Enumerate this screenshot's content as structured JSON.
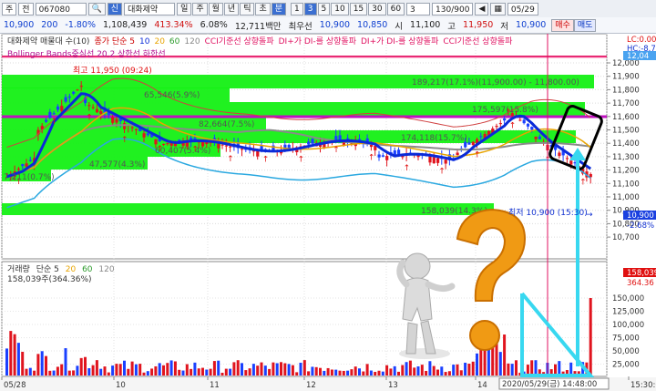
{
  "toolbar": {
    "market_label": "주",
    "period_label": "전",
    "code": "067080",
    "stock_name": "대화제약",
    "period_buttons": [
      "일",
      "주",
      "월",
      "년",
      "틱",
      "초",
      "분"
    ],
    "minute_buttons": [
      "1",
      "3",
      "5",
      "10",
      "15",
      "30",
      "60"
    ],
    "count_value": "3",
    "range_value": "130/900",
    "date_value": "05/29"
  },
  "quote": {
    "price": "10,900",
    "change": "200",
    "change_pct": "-1.80%",
    "volume": "1,108,439",
    "volume_ratio": "413.34%",
    "turnover": "6.08%",
    "trade_amount": "12,711백만",
    "best_label": "최우선",
    "ask": "10,900",
    "bid": "10,850",
    "open_label": "시",
    "open": "11,100",
    "high_label": "고",
    "high": "11,950",
    "close_label": "저",
    "low": "10,900",
    "buy_button": "매수",
    "sell_button": "매도"
  },
  "price_panel": {
    "legend_line1": [
      "대화제약 매물대 수(10)",
      "종가 단순 5",
      "10",
      "20",
      "60",
      "120",
      "CCI기준선 상향돌파",
      "DI+가 DI-를 상향돌파",
      "DI+가 DI-를 상향돌파",
      "CCI기준선 상향돌파"
    ],
    "legend_line2": "Bollinger Bands중심선 20,2 상한선 하한선",
    "right_top": [
      "LC:0.00%",
      "HC:-8.79"
    ],
    "y_ticks": [
      "12,000",
      "11,900",
      "11,800",
      "11,700",
      "11,600",
      "11,500",
      "11,400",
      "11,300",
      "11,200",
      "11,100",
      "11,000",
      "10,900",
      "10,800",
      "10,700"
    ],
    "current_price_tag": "10,900",
    "current_pct_tag": "-2.68%",
    "top_tag": "12,04",
    "annotations": {
      "high": "최고 11,950 (09:24)",
      "low": "최저 10,900 (15:30)",
      "vp": [
        "189,217(17.1%)(11,900.00) - 11,800.00)",
        "65,546(5.9%)",
        "175,597(15.8%)",
        "82,664(7.5%)",
        "174,118(15.7%)",
        "60,407(5.4%)",
        "47,577(4.3%)",
        "7,211(0.7%)",
        "158,039(14.3%)"
      ]
    }
  },
  "volume_panel": {
    "legend": [
      "거래량",
      "단순 5",
      "20",
      "60",
      "120"
    ],
    "value_line": "158,039주(364.36%)",
    "y_ticks": [
      "150,000",
      "125,000",
      "100,000",
      "75,000",
      "50,000",
      "25,000"
    ],
    "tags": [
      "158,039",
      "364.36"
    ]
  },
  "x_axis": {
    "labels": [
      "05/28",
      "10",
      "11",
      "12",
      "13",
      "14",
      "15:30:00"
    ],
    "cursor_time": "2020/05/29(금) 14:48:00"
  },
  "colors": {
    "up": "#e0141e",
    "down": "#1a40ff",
    "vp_band": "#14f014",
    "ma5": "#0a2ad8",
    "bb": "#2aa8e0"
  }
}
